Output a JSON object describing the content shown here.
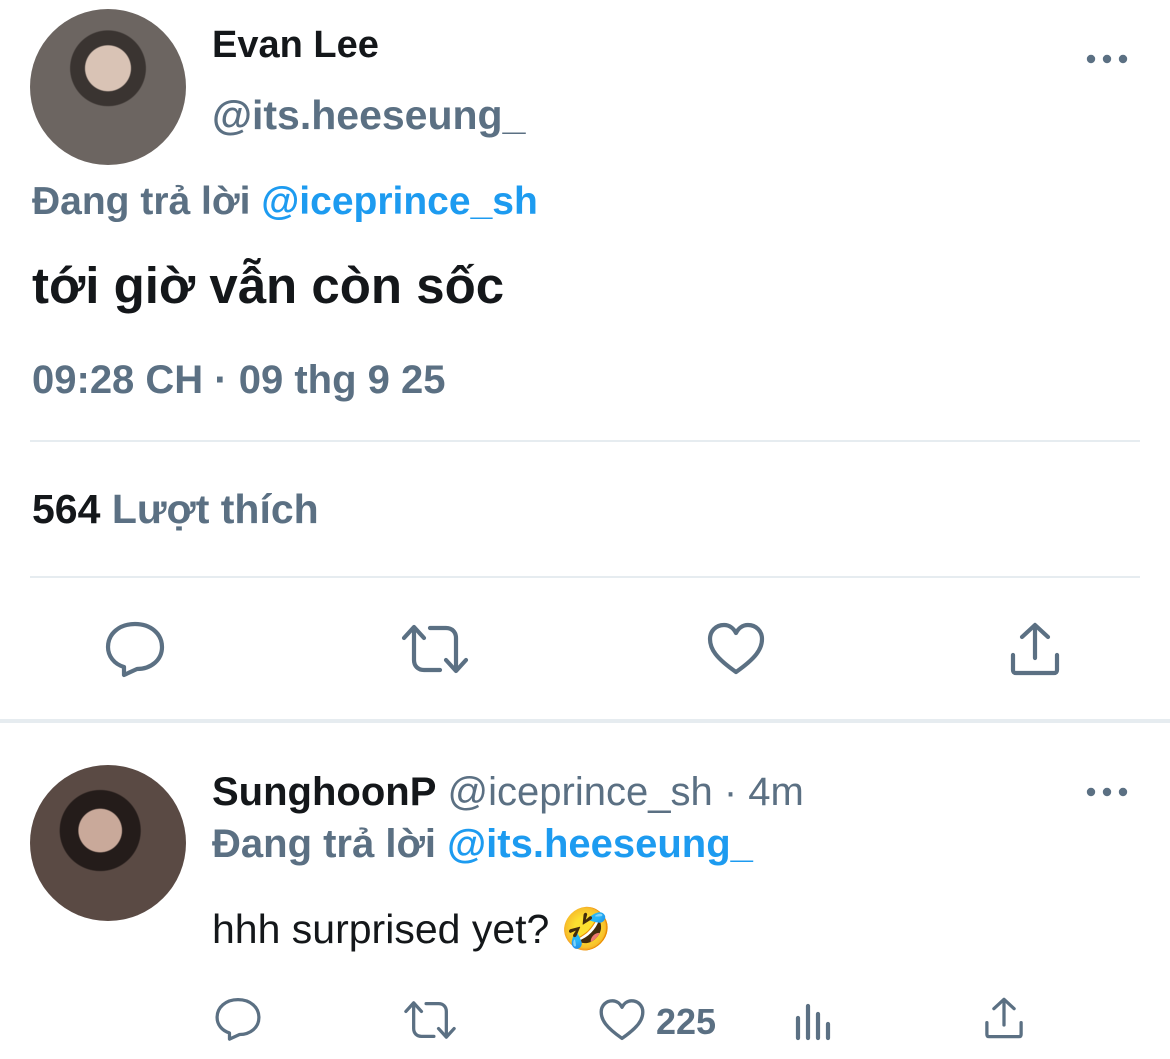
{
  "tweet": {
    "author_name": "Evan Lee",
    "author_handle": "@its.heeseung_",
    "replying_prefix": "Đang trả lời",
    "replying_to": "@iceprince_sh",
    "text": "tới giờ vẫn còn sốc",
    "timestamp": "09:28 CH · 09 thg 9 25",
    "likes_count": "564",
    "likes_label": "Lượt thích",
    "more_icon": "more-horizontal-icon",
    "actions": [
      "reply-icon",
      "retweet-icon",
      "like-icon",
      "share-icon"
    ]
  },
  "reply": {
    "author_name": "SunghoonP",
    "author_handle": "@iceprince_sh",
    "time": "· 4m",
    "replying_prefix": "Đang trả lời",
    "replying_to": "@its.heeseung_",
    "text": "hhh surprised yet? 🤣",
    "like_count": "225",
    "actions": [
      "reply-icon",
      "retweet-icon",
      "like-icon",
      "analytics-icon",
      "share-icon"
    ]
  },
  "colors": {
    "accent": "#1d9bf0",
    "muted": "#5b7083",
    "divider": "#e6ecf0"
  }
}
